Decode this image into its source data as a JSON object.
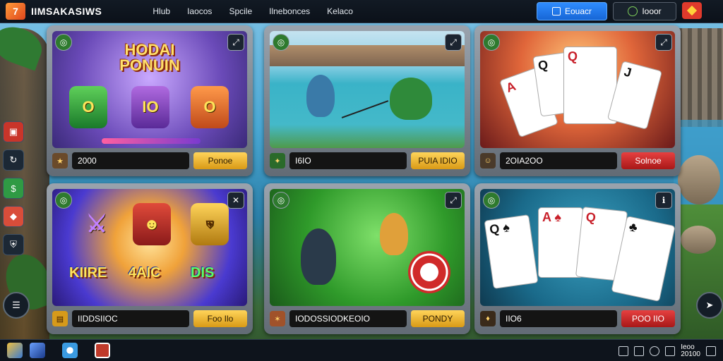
{
  "app": {
    "title": "IIMSAKASIWS",
    "logo_glyph": "7"
  },
  "nav": [
    "Hlub",
    "Iaocos",
    "Spcile",
    "Ilnebonces",
    "Kelaco"
  ],
  "actions": {
    "primary_label": "Eouacr",
    "secondary_label": "Iooor"
  },
  "colors": {
    "accent": "#1f7ae8",
    "gold": "#e0a822",
    "red": "#c82a2a"
  },
  "rail": [
    "slots-icon",
    "refresh-icon",
    "money-icon",
    "gift-icon",
    "shield-icon"
  ],
  "cards": [
    {
      "title_art": "HODAI PONUIN",
      "gems": [
        "O",
        "IO",
        "O"
      ],
      "value": "2000",
      "button": "Ponoe",
      "button_style": "gold"
    },
    {
      "value": "I6IO",
      "button": "PUIA IDIO",
      "button_style": "gold"
    },
    {
      "value": "2OIA2OO",
      "button": "Solnoe",
      "button_style": "red"
    },
    {
      "words": [
        "KIIRE",
        "4AIC",
        "DIS"
      ],
      "value": "IIDDSIIOC",
      "button": "Foo Ilo",
      "button_style": "gold"
    },
    {
      "value": "IODOSSIODKEOIO",
      "button": "PONDY",
      "button_style": "gold"
    },
    {
      "value": "IIO6",
      "button": "POO IIO",
      "button_style": "red"
    }
  ],
  "tray": {
    "time": "Ieoo",
    "date": "20100"
  }
}
